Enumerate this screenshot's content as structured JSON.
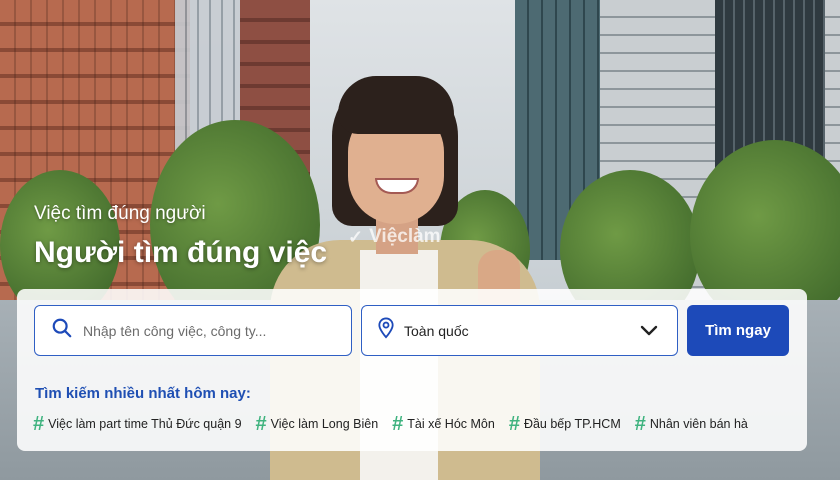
{
  "hero": {
    "subtitle": "Việc tìm đúng người",
    "title": "Người tìm đúng việc",
    "watermark": "Việclàm"
  },
  "search": {
    "keyword_placeholder": "Nhập tên công việc, công ty...",
    "keyword_value": "",
    "location_value": "Toàn quốc",
    "button_label": "Tìm ngay"
  },
  "trending": {
    "title": "Tìm kiếm nhiều nhất hôm nay:",
    "hash_symbol": "#",
    "tags": [
      "Việc làm part time Thủ Đức quận 9",
      "Việc làm Long Biên",
      "Tài xế Hóc Môn",
      "Đầu bếp TP.HCM",
      "Nhân viên bán hà"
    ]
  },
  "colors": {
    "primary": "#1d4ab9",
    "tag_hash": "#3fb37f",
    "field_border": "#2f5fc4"
  },
  "icons": [
    "search-icon",
    "location-pin-icon",
    "chevron-down-icon"
  ]
}
